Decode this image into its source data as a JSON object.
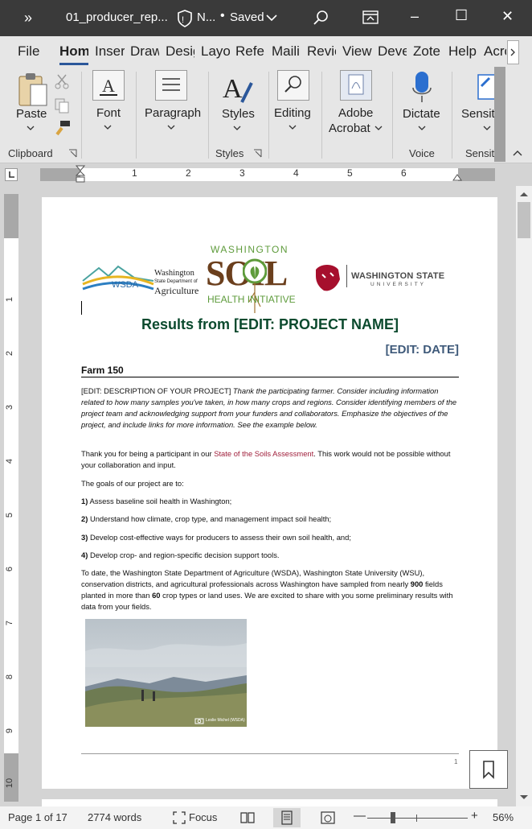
{
  "titlebar": {
    "overflow_label": "»",
    "filename": "01_producer_rep...",
    "label_short": "N...",
    "saved": "Saved",
    "win_min": "–",
    "win_max": "☐",
    "win_close": "✕"
  },
  "tabs": [
    "File",
    "Hom",
    "Inser",
    "Draw",
    "Desig",
    "Layo",
    "Refer",
    "Maili",
    "Revie",
    "View",
    "Deve",
    "Zote",
    "Help",
    "Acro"
  ],
  "ribbon": {
    "paste": "Paste",
    "clipboard": "Clipboard",
    "font": "Font",
    "paragraph": "Paragraph",
    "styles": "Styles",
    "styles_group": "Styles",
    "editing": "Editing",
    "adobe1": "Adobe",
    "adobe2": "Acrobat",
    "dictate": "Dictate",
    "voice": "Voice",
    "sensi": "Sensiti",
    "sensi_group": "Sensiti"
  },
  "ruler": [
    "1",
    "2",
    "3",
    "4",
    "5",
    "6"
  ],
  "vruler": [
    "1",
    "2",
    "3",
    "4",
    "5",
    "6",
    "7",
    "8",
    "9",
    "10"
  ],
  "doc": {
    "logo_wsda_text": "WSDA",
    "logo_wsda_line1": "Washington",
    "logo_wsda_line2": "State Department of",
    "logo_wsda_line3": "Agriculture",
    "logo_soil_top": "WASHINGTON",
    "logo_soil_main": "SOIL",
    "logo_soil_bottom": "HEALTH INITIATIVE",
    "logo_wsu_line1": "WASHINGTON STATE",
    "logo_wsu_line2": "UNIVERSITY",
    "title": "Results from [EDIT: PROJECT NAME]",
    "date": "[EDIT: DATE]",
    "farm": "Farm 150",
    "desc_lead": "[EDIT: DESCRIPTION OF YOUR PROJECT]",
    "desc_italic": "Thank the participating farmer. Consider including information related to how many samples you've taken, in how many crops and regions. Consider identifying members of the project team and acknowledging support from your funders and collaborators. Emphasize the objectives of the project, and include links for more information. See the example below.",
    "thanks_a": "Thank you for being a participant in our ",
    "thanks_link": "State of the Soils Assessment",
    "thanks_b": ". This work would not be possible without your collaboration and input.",
    "goals_intro": "The goals of our project are to:",
    "goals": [
      {
        "n": "1)",
        "t": "Assess baseline soil health in Washington;"
      },
      {
        "n": "2)",
        "t": "Understand how climate, crop type, and management impact soil health;"
      },
      {
        "n": "3)",
        "t": "Develop cost-effective ways for producers to assess their own soil health, and;"
      },
      {
        "n": "4)",
        "t": "Develop crop- and region-specific decision support tools."
      }
    ],
    "todate_a": "To date, the Washington State Department of Agriculture (WSDA), Washington State University (WSU), conservation districts, and agricultural professionals across Washington have sampled from nearly ",
    "todate_b1": "900",
    "todate_c": " fields planted in more than ",
    "todate_b2": "60",
    "todate_d": " crop types or land uses. We are excited to share with you some preliminary results with data from your fields.",
    "photo_credit": "Leslie Michel (WSDA)",
    "page_num": "1"
  },
  "status": {
    "page": "Page 1 of 17",
    "words": "2774 words",
    "focus": "Focus",
    "zoom_minus": "—",
    "zoom_plus": "+",
    "zoom": "56%"
  },
  "colors": {
    "title_green": "#0b4a2e",
    "date_blue": "#3f5a7a",
    "accent": "#2b579a"
  }
}
